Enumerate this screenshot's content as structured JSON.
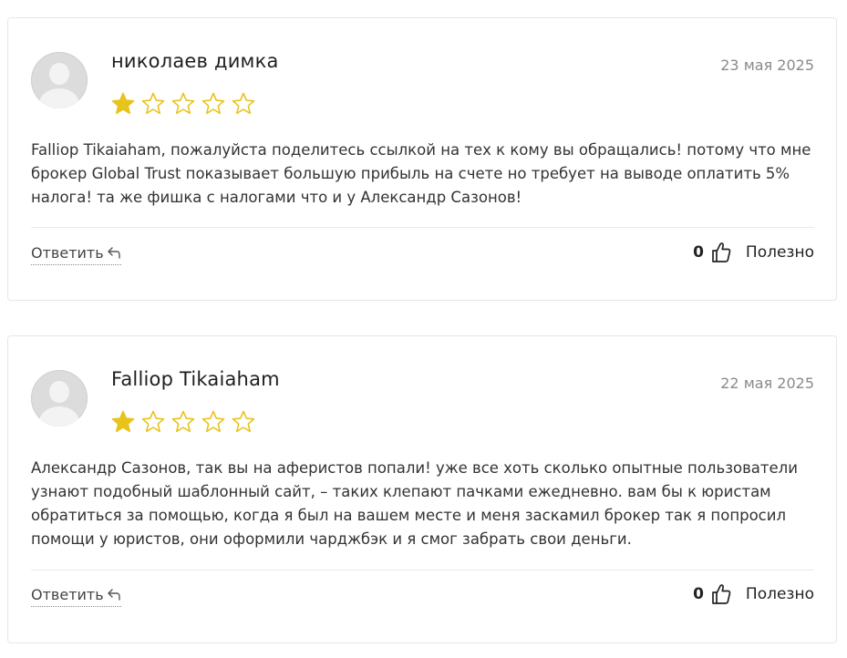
{
  "reviews": [
    {
      "author": "николаев димка",
      "date": "23 мая 2025",
      "rating": 1,
      "max_rating": 5,
      "text": "Falliop Tikaiaham, пожалуйста поделитесь ссылкой на тех к кому вы обращались! потому что мне брокер Global Trust показывает большую прибыль на счете но требует на выводе оплатить 5% налога! та же фишка с налогами что и у Александр Сазонов!",
      "reply_label": "Ответить",
      "helpful_count": "0",
      "helpful_label": "Полезно"
    },
    {
      "author": "Falliop Tikaiaham",
      "date": "22 мая 2025",
      "rating": 1,
      "max_rating": 5,
      "text": "Александр Сазонов, так вы на аферистов попали! уже все хоть сколько опытные пользователи узнают подобный шаблонный сайт, – таких клепают пачками ежедневно. вам бы к юристам обратиться за помощью, когда я был на вашем месте и меня заскамил брокер так я попросил помощи у юристов, они оформили чарджбэк и я смог забрать свои деньги.",
      "reply_label": "Ответить",
      "helpful_count": "0",
      "helpful_label": "Полезно"
    }
  ],
  "colors": {
    "star_filled": "#e8c31c",
    "star_outline": "#e8c31c",
    "border": "#e6e6e6",
    "date": "#8a8a8a"
  },
  "icons": {
    "avatar": "default-avatar-icon",
    "star": "star-icon",
    "reply": "reply-arrow-icon",
    "helpful": "thumbs-up-icon"
  }
}
